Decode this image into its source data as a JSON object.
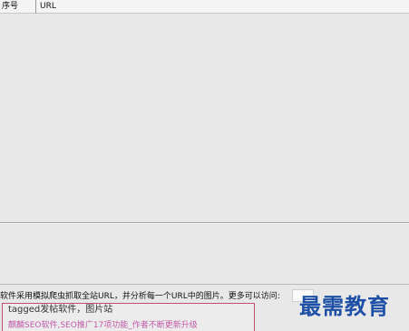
{
  "table": {
    "columns": [
      "序号",
      "URL"
    ]
  },
  "footer": {
    "description": "软件采用模拟爬虫抓取全站URL，并分析每一个URL中的图片。更多可以访问:",
    "ad_line1": "tagged发帖软件，图片站",
    "ad_line2": "麒麟SEO软件,SEO推广17项功能_作者不断更新升级"
  },
  "watermark": {
    "text": "最需教育"
  }
}
